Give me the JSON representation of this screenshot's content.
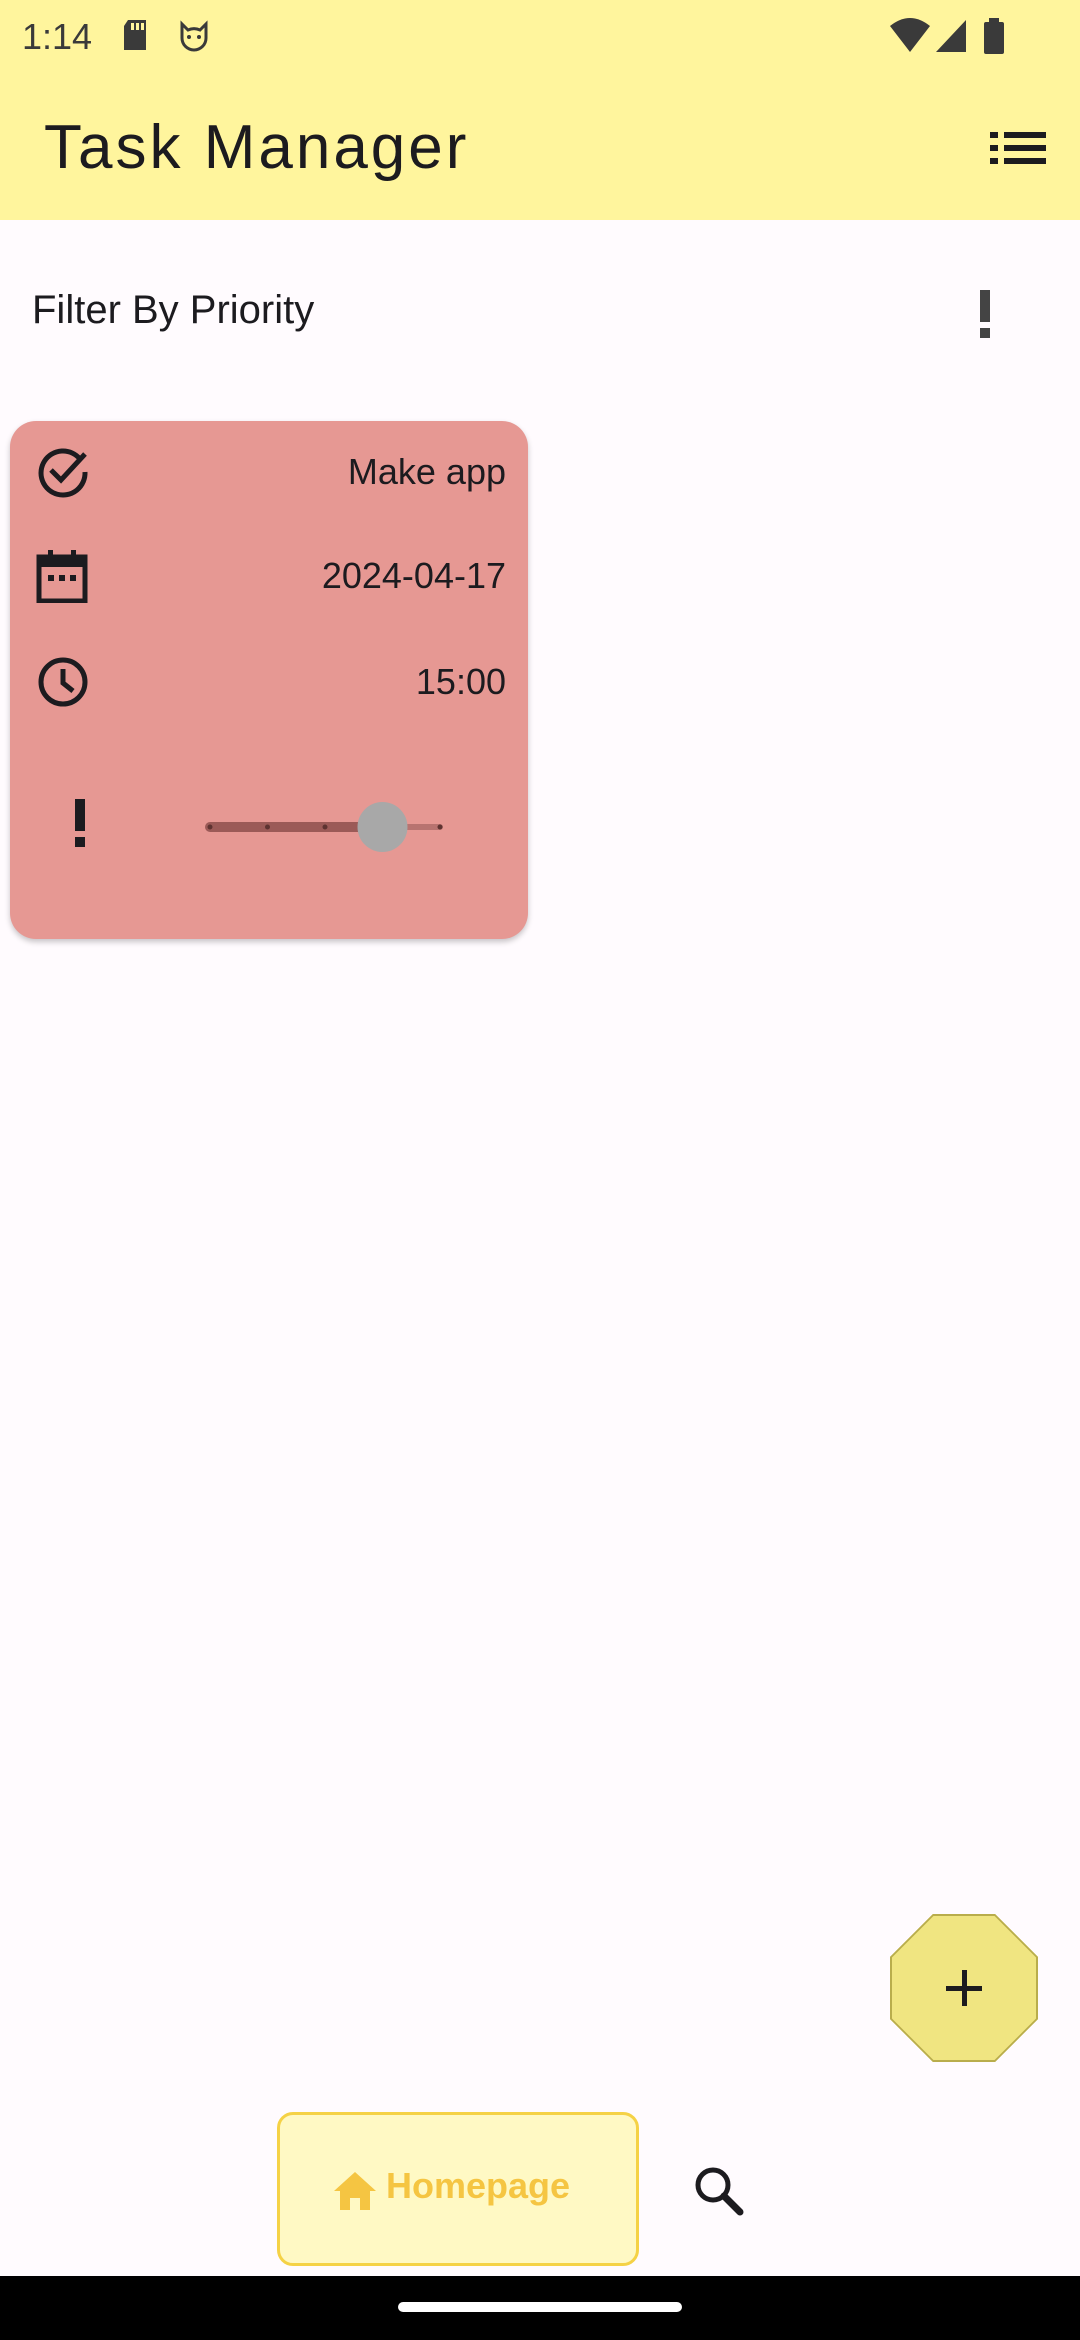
{
  "status_bar": {
    "time": "1:14",
    "icons": [
      "sd-card-icon",
      "cat-face-icon",
      "wifi-icon",
      "signal-icon",
      "battery-icon"
    ]
  },
  "app_bar": {
    "title": "Task Manager",
    "menu_icon": "list-icon"
  },
  "filter": {
    "label": "Filter By Priority",
    "icon": "priority-high-icon"
  },
  "task_card": {
    "background_color": "#e69893",
    "title": "Make app",
    "date": "2024-04-17",
    "time": "15:00",
    "priority_icon": "priority-high-icon",
    "priority_slider": {
      "min": 0,
      "max": 4,
      "value": 3
    }
  },
  "fab": {
    "icon": "plus-icon",
    "color": "#f0e581"
  },
  "bottom_nav": {
    "items": [
      {
        "label": "Homepage",
        "icon": "home-icon",
        "active": true
      },
      {
        "label": "",
        "icon": "search-icon",
        "active": false
      }
    ],
    "accent_color": "#f5c542"
  }
}
